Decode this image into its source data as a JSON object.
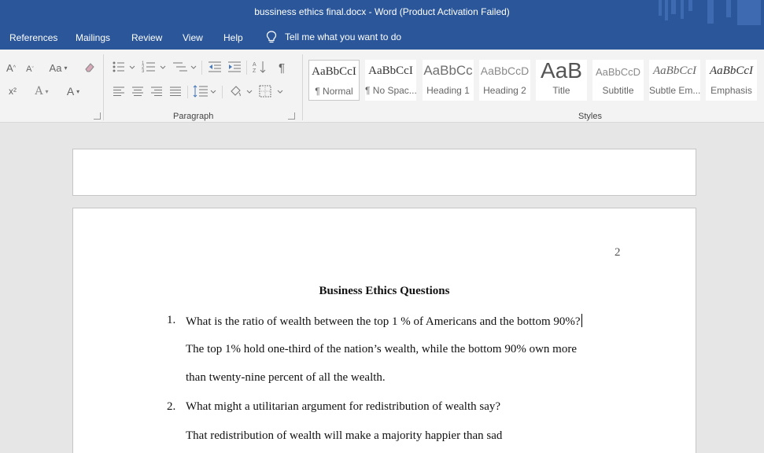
{
  "window": {
    "title": "bussiness ethics final.docx  -  Word (Product Activation Failed)",
    "accent": "#2b579a"
  },
  "menu": {
    "tabs": [
      "References",
      "Mailings",
      "Review",
      "View",
      "Help"
    ],
    "tell_me": "Tell me what you want to do",
    "tell_me_icon": "lightbulb-icon"
  },
  "ribbon": {
    "font_group": {
      "grow": "A",
      "shrink": "A",
      "case": "Aa",
      "clear_icon": "eraser-icon",
      "superscript": "x²",
      "effects": "A",
      "font_color": "A"
    },
    "paragraph_label": "Paragraph",
    "paragraph_icons": [
      "bullets-icon",
      "numbering-icon",
      "multilevel-list-icon",
      "decrease-indent-icon",
      "increase-indent-icon",
      "sort-icon",
      "pilcrow-icon",
      "align-left-icon",
      "center-icon",
      "align-right-icon",
      "justify-icon",
      "line-spacing-icon",
      "shading-icon",
      "borders-icon"
    ],
    "pilcrow": "¶",
    "styles_label": "Styles",
    "styles": [
      {
        "preview": "AaBbCcI",
        "name": "¶ Normal"
      },
      {
        "preview": "AaBbCcI",
        "name": "¶ No Spac..."
      },
      {
        "preview": "AaBbCc",
        "name": "Heading 1"
      },
      {
        "preview": "AaBbCcD",
        "name": "Heading 2"
      },
      {
        "preview": "AaB",
        "name": "Title"
      },
      {
        "preview": "AaBbCcD",
        "name": "Subtitle"
      },
      {
        "preview": "AaBbCcI",
        "name": "Subtle Em..."
      },
      {
        "preview": "AaBbCcI",
        "name": "Emphasis"
      }
    ]
  },
  "document": {
    "page_number": "2",
    "heading": "Business Ethics Questions",
    "items": [
      {
        "number": "1.",
        "question": "What is the ratio of wealth between the top 1 % of Americans and the bottom 90%?",
        "answer_lines": [
          "The top 1% hold one-third of the nation’s wealth, while the bottom 90% own more",
          "than twenty-nine percent of all the wealth."
        ]
      },
      {
        "number": "2.",
        "question": "What might a utilitarian argument for redistribution of wealth say?",
        "answer_lines": [
          "That redistribution of wealth will make a majority happier than sad"
        ]
      }
    ]
  }
}
